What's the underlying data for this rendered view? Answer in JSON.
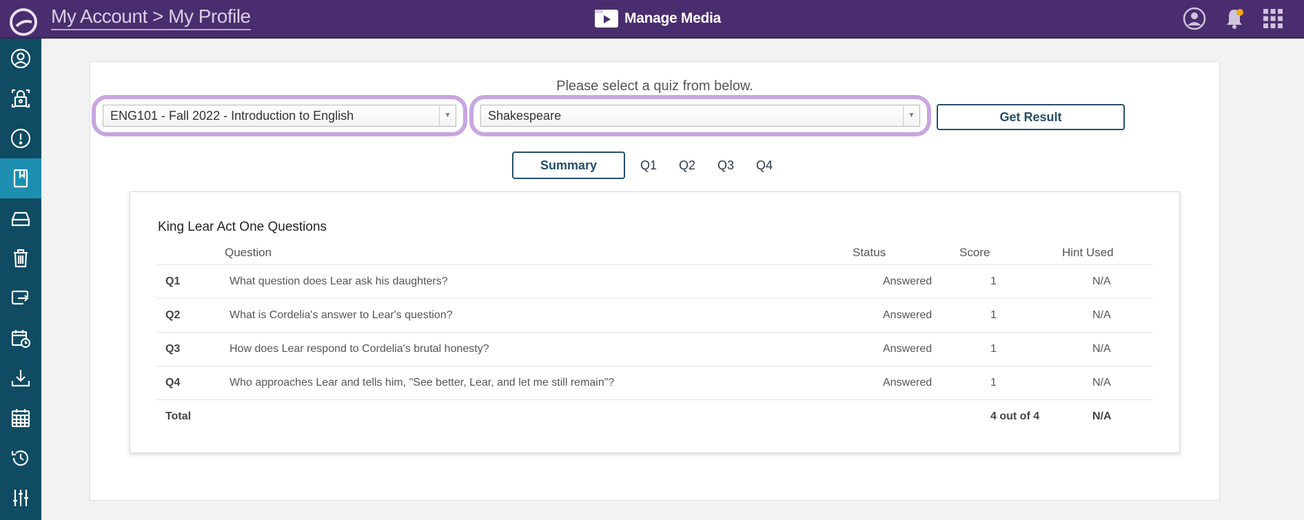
{
  "header": {
    "breadcrumb": "My Account > My Profile",
    "manage_media_label": "Manage Media"
  },
  "colors": {
    "topbar": "#4a2d6e",
    "sidebar": "#0f4b63",
    "sidebar_active": "#1e8fb0",
    "highlight": "#c7a6df",
    "button_border": "#244f6b"
  },
  "sidebar": {
    "items": [
      {
        "icon": "user-circle-icon",
        "active": false
      },
      {
        "icon": "lock-icon",
        "active": false
      },
      {
        "icon": "alert-icon",
        "active": false
      },
      {
        "icon": "bookmark-book-icon",
        "active": true
      },
      {
        "icon": "drive-icon",
        "active": false
      },
      {
        "icon": "trash-icon",
        "active": false
      },
      {
        "icon": "share-icon",
        "active": false
      },
      {
        "icon": "calendar-clock-icon",
        "active": false
      },
      {
        "icon": "download-icon",
        "active": false
      },
      {
        "icon": "calendar-icon",
        "active": false
      },
      {
        "icon": "history-icon",
        "active": false
      },
      {
        "icon": "sliders-icon",
        "active": false
      }
    ]
  },
  "main": {
    "prompt": "Please select a quiz from below.",
    "course_select": {
      "value": "ENG101 - Fall 2022 - Introduction to English"
    },
    "quiz_select": {
      "value": "Shakespeare"
    },
    "get_result_label": "Get Result",
    "tabs": [
      {
        "label": "Summary",
        "active": true
      },
      {
        "label": "Q1",
        "active": false
      },
      {
        "label": "Q2",
        "active": false
      },
      {
        "label": "Q3",
        "active": false
      },
      {
        "label": "Q4",
        "active": false
      }
    ],
    "results": {
      "title": "King Lear Act One Questions",
      "columns": {
        "question": "Question",
        "status": "Status",
        "score": "Score",
        "hint": "Hint Used"
      },
      "rows": [
        {
          "id": "Q1",
          "question": "What question does Lear ask his daughters?",
          "status": "Answered",
          "score": "1",
          "hint": "N/A"
        },
        {
          "id": "Q2",
          "question": "What is Cordelia's answer to Lear's question?",
          "status": "Answered",
          "score": "1",
          "hint": "N/A"
        },
        {
          "id": "Q3",
          "question": "How does Lear respond to Cordelia's brutal honesty?",
          "status": "Answered",
          "score": "1",
          "hint": "N/A"
        },
        {
          "id": "Q4",
          "question": "Who approaches Lear and tells him, \"See better, Lear, and let me still remain\"?",
          "status": "Answered",
          "score": "1",
          "hint": "N/A"
        }
      ],
      "total": {
        "label": "Total",
        "score": "4 out of 4",
        "hint": "N/A"
      }
    }
  }
}
